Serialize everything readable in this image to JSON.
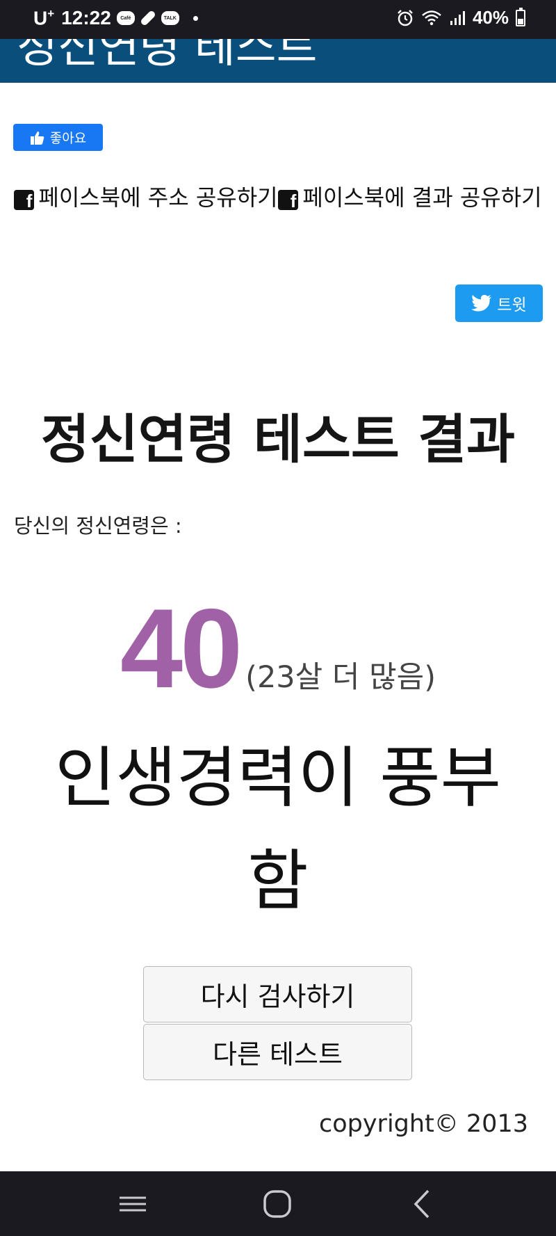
{
  "status_bar": {
    "carrier": "U",
    "carrier_sup": "+",
    "time": "12:22",
    "notification_icons": [
      "Café",
      "pill-icon",
      "TALK"
    ],
    "battery": "40%"
  },
  "header": {
    "title": "정신연령 테스트"
  },
  "social": {
    "like_label": "좋아요",
    "share_address_label": "페이스북에 주소 공유하기",
    "share_result_label": "페이스북에 결과 공유하기",
    "tweet_label": "트윗",
    "colors": {
      "facebook": "#1877f2",
      "twitter": "#1d9bf0"
    }
  },
  "result": {
    "title": "정신연령 테스트 결과",
    "intro": "당신의 정신연령은 :",
    "age": "40",
    "age_diff": "(23살 더 많음)",
    "description": "인생경력이 풍부함",
    "age_color": "#a161a6"
  },
  "actions": {
    "retry_label": "다시 검사하기",
    "other_label": "다른 테스트"
  },
  "footer": {
    "copyright": "copyright© 2013"
  },
  "nav_bar": {
    "icons": [
      "recent-apps-icon",
      "home-icon",
      "back-icon"
    ]
  }
}
